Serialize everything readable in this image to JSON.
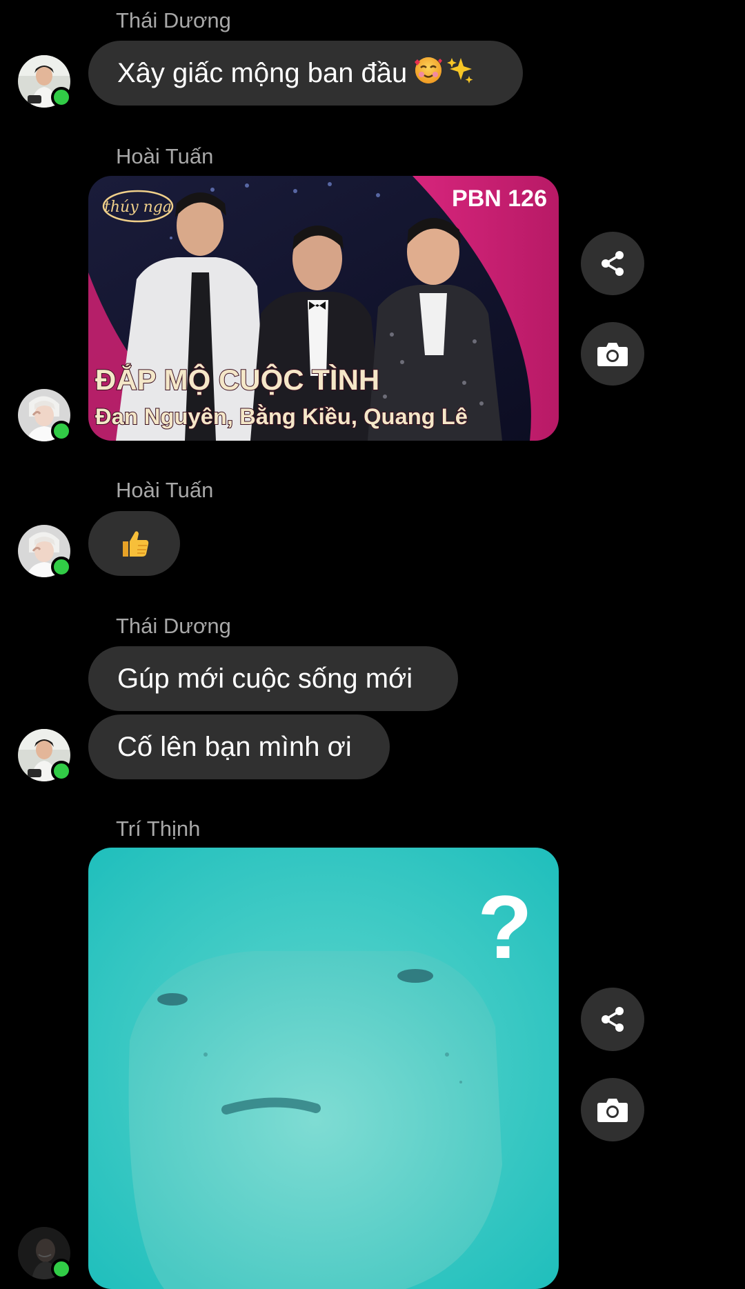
{
  "colors": {
    "background": "#000000",
    "bubble": "#303030",
    "sender_name": "#a8a8a8",
    "online_dot": "#31cc46",
    "banner_pink": "#c2206f",
    "meme_teal": "#24c3c0"
  },
  "messages": [
    {
      "sender": "Thái Dương",
      "text": "Xây giấc mộng ban đầu",
      "emojis": [
        "smiling-face-with-hearts-icon",
        "sparkles-icon"
      ]
    },
    {
      "sender": "Hoài Tuấn",
      "video": {
        "channel_logo": "thúy nga",
        "episode": "PBN 126",
        "title": "ĐẮP MỘ CUỘC TÌNH",
        "artists": "Đan Nguyên, Bằng Kiều, Quang Lê"
      },
      "actions": [
        "share-icon",
        "camera-icon"
      ]
    },
    {
      "sender": "Hoài Tuấn",
      "emoji": "thumbs-up-icon"
    },
    {
      "sender": "Thái Dương",
      "texts": [
        "Gúp mới cuộc sống mới",
        "Cố lên bạn mình ơi"
      ]
    },
    {
      "sender": "Trí Thịnh",
      "meme": {
        "overlay_text": "?"
      },
      "actions": [
        "share-icon",
        "camera-icon"
      ]
    }
  ]
}
